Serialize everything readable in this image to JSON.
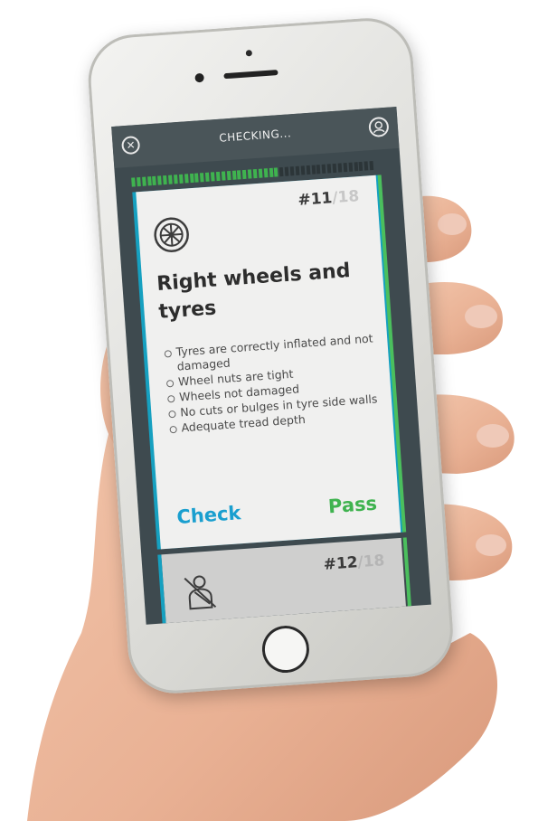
{
  "app": {
    "header_title": "CHECKING...",
    "close_icon": "close-icon",
    "profile_icon": "profile-icon"
  },
  "progress": {
    "completed": 11,
    "total": 18,
    "fraction": 0.61,
    "done_color": "#3fb34f",
    "todo_color": "#2c3538"
  },
  "current_card": {
    "number": "#11",
    "total": "/18",
    "icon": "wheel-icon",
    "title": "Right wheels and tyres",
    "items": [
      "Tyres are correctly inflated and not damaged",
      "Wheel nuts are tight",
      "Wheels not damaged",
      "No cuts or bulges in tyre side walls",
      "Adequate tread depth"
    ],
    "check_label": "Check",
    "pass_label": "Pass"
  },
  "next_card": {
    "number": "#12",
    "total": "/18",
    "icon": "seatbelt-icon"
  },
  "colors": {
    "check": "#1a9fcf",
    "pass": "#3fb34f",
    "header_bg": "#4a5559"
  }
}
